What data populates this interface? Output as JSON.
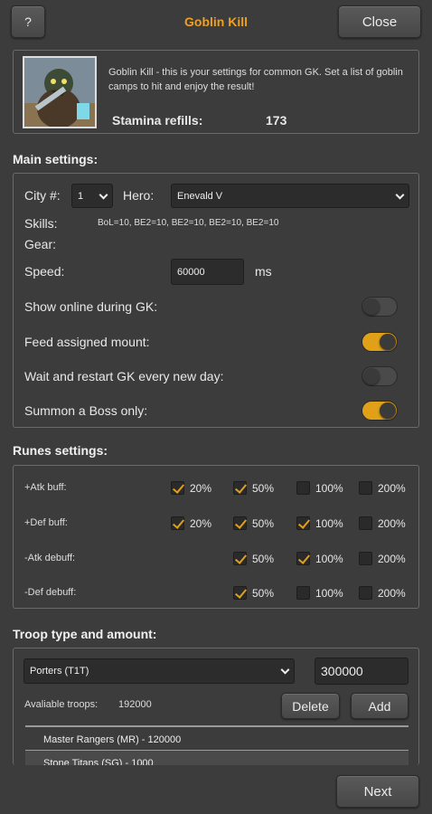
{
  "header": {
    "help_label": "?",
    "title": "Goblin Kill",
    "close_label": "Close",
    "title_color": "#f0a020"
  },
  "intro": {
    "description": "Goblin Kill - this is your settings for common GK. Set a list of goblin camps to hit and enjoy the result!",
    "stamina_label": "Stamina refills:",
    "stamina_value": "173"
  },
  "main": {
    "title": "Main settings:",
    "city_label": "City #:",
    "city_value": "1",
    "hero_label": "Hero:",
    "hero_value": "Enevald V",
    "skills_label": "Skills:",
    "skills_value": "BoL=10, BE2=10, BE2=10, BE2=10, BE2=10",
    "gear_label": "Gear:",
    "speed_label": "Speed:",
    "speed_value": "60000",
    "speed_unit": "ms",
    "toggles": [
      {
        "label": "Show online during GK:",
        "on": false
      },
      {
        "label": "Feed assigned mount:",
        "on": true
      },
      {
        "label": "Wait and restart GK every new day:",
        "on": false
      },
      {
        "label": "Summon a Boss only:",
        "on": true
      }
    ]
  },
  "runes": {
    "title": "Runes settings:",
    "rows": [
      {
        "label": "+Atk buff:",
        "options": [
          {
            "pct": "20%",
            "checked": true
          },
          {
            "pct": "50%",
            "checked": true
          },
          {
            "pct": "100%",
            "checked": false
          },
          {
            "pct": "200%",
            "checked": false
          }
        ]
      },
      {
        "label": "+Def buff:",
        "options": [
          {
            "pct": "20%",
            "checked": true
          },
          {
            "pct": "50%",
            "checked": true
          },
          {
            "pct": "100%",
            "checked": true
          },
          {
            "pct": "200%",
            "checked": false
          }
        ]
      },
      {
        "label": "-Atk debuff:",
        "options": [
          null,
          {
            "pct": "50%",
            "checked": true
          },
          {
            "pct": "100%",
            "checked": true
          },
          {
            "pct": "200%",
            "checked": false
          }
        ]
      },
      {
        "label": "-Def debuff:",
        "options": [
          null,
          {
            "pct": "50%",
            "checked": true
          },
          {
            "pct": "100%",
            "checked": false
          },
          {
            "pct": "200%",
            "checked": false
          }
        ]
      }
    ]
  },
  "troops": {
    "title": "Troop type and amount:",
    "type_value": "Porters (T1T)",
    "amount_value": "300000",
    "available_label": "Avaliable troops:",
    "available_value": "192000",
    "delete_label": "Delete",
    "add_label": "Add",
    "list": [
      "Master Rangers (MR) - 120000",
      "Stone Titans (SG) - 1000"
    ]
  },
  "footer": {
    "next_label": "Next"
  }
}
